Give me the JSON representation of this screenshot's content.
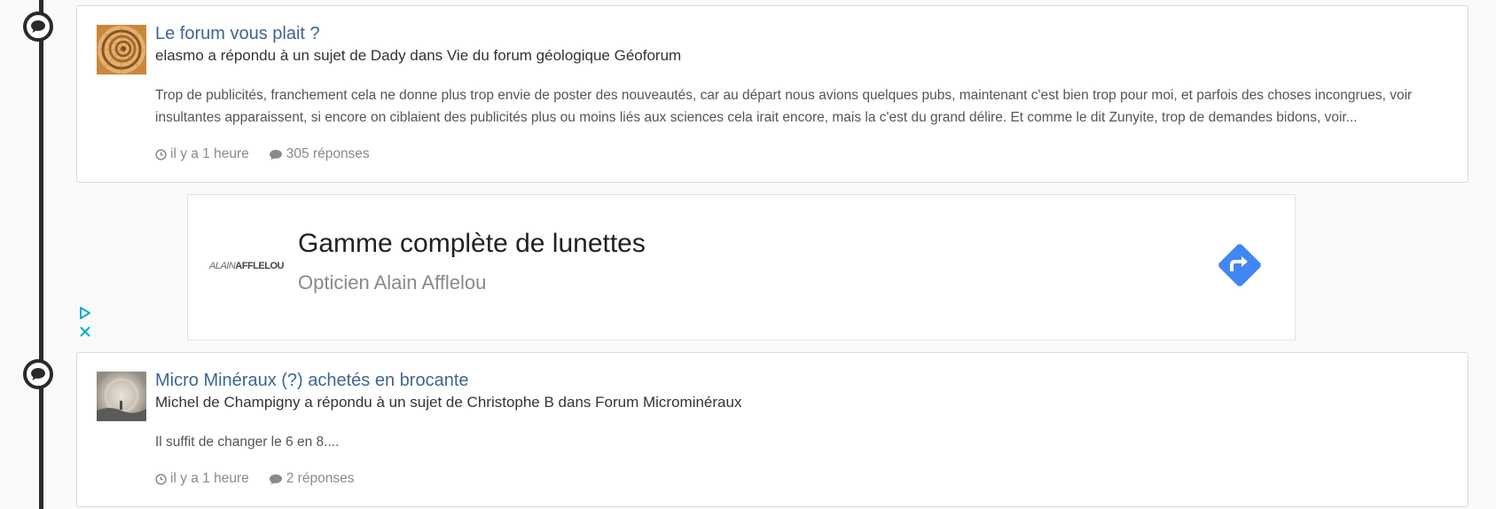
{
  "posts": [
    {
      "title": "Le forum vous plait ?",
      "subtitle": "elasmo a répondu à un sujet de Dady dans Vie du forum géologique Géoforum",
      "excerpt": "Trop de publicités, franchement cela ne donne plus trop envie de poster des nouveautés, car au départ nous avions quelques pubs, maintenant c'est bien trop pour moi, et parfois des choses incongrues, voir insultantes apparaissent, si encore on ciblaient des publicités plus ou moins liés aux sciences cela irait encore, mais la c'est du grand délire. Et comme le dit Zunyite, trop de demandes bidons, voir...",
      "time": "il y a 1 heure",
      "replies": "305 réponses"
    },
    {
      "title": "Micro Minéraux (?) achetés en brocante",
      "subtitle": "Michel de Champigny a répondu à un sujet de Christophe B dans Forum Microminéraux",
      "excerpt": "Il suffit de changer le 6 en 8....",
      "time": "il y a 1 heure",
      "replies": "2 réponses"
    }
  ],
  "ad": {
    "logo_part1": "ALAIN",
    "logo_part2": "AFFLELOU",
    "headline": "Gamme complète de lunettes",
    "advertiser": "Opticien Alain Afflelou",
    "cta_icon": "directions-arrow-icon",
    "adchoices_icons": [
      "adchoices-play-icon",
      "ad-close-icon"
    ]
  },
  "icons": {
    "timeline_marker": "comment-bubble-icon",
    "time": "clock-icon",
    "replies": "comment-icon"
  },
  "colors": {
    "title_link": "#3d6594",
    "ad_cta": "#4285f4",
    "adchoices": "#00aecd",
    "timeline": "#2a2a2a"
  }
}
